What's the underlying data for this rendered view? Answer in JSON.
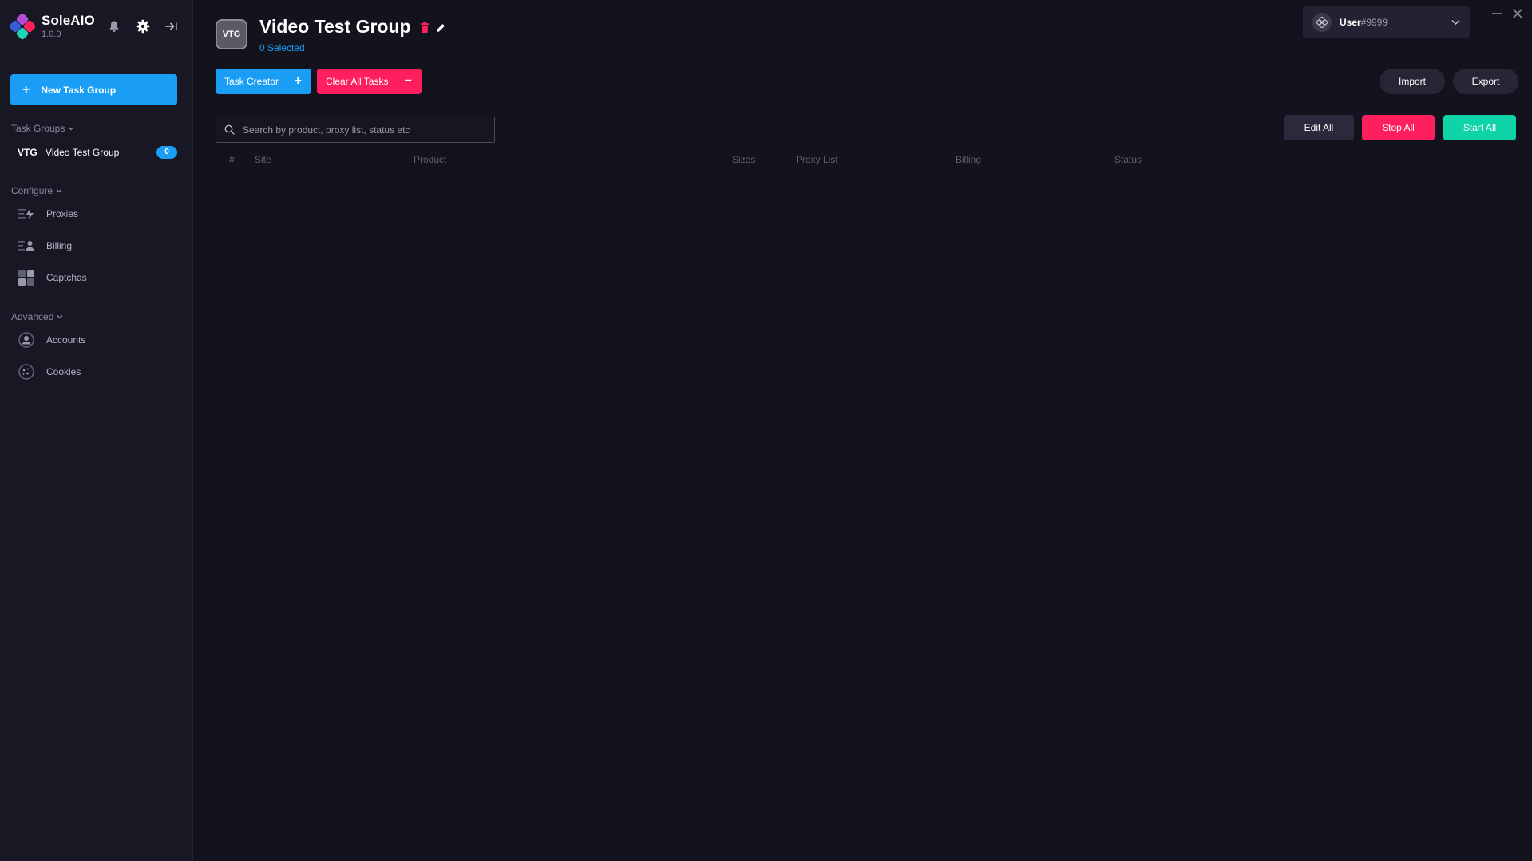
{
  "app": {
    "name": "SoleAIO",
    "version": "1.0.0"
  },
  "sidebar": {
    "new_task_group_label": "New Task Group",
    "task_groups_label": "Task Groups",
    "groups": [
      {
        "abbr": "VTG",
        "name": "Video Test Group",
        "count": "0"
      }
    ],
    "configure_label": "Configure",
    "configure_items": [
      {
        "label": "Proxies",
        "icon": "proxies-icon"
      },
      {
        "label": "Billing",
        "icon": "billing-icon"
      },
      {
        "label": "Captchas",
        "icon": "captchas-icon"
      }
    ],
    "advanced_label": "Advanced",
    "advanced_items": [
      {
        "label": "Accounts",
        "icon": "accounts-icon"
      },
      {
        "label": "Cookies",
        "icon": "cookies-icon"
      }
    ]
  },
  "header": {
    "group_abbr": "VTG",
    "title": "Video Test Group",
    "selected": "0 Selected"
  },
  "toolbar": {
    "task_creator_label": "Task Creator",
    "clear_all_label": "Clear All Tasks",
    "import_label": "Import",
    "export_label": "Export",
    "edit_all_label": "Edit All",
    "stop_all_label": "Stop All",
    "start_all_label": "Start All"
  },
  "search": {
    "placeholder": "Search by product, proxy list, status etc",
    "value": ""
  },
  "table": {
    "columns": [
      "#",
      "Site",
      "Product",
      "Sizes",
      "Proxy List",
      "Billing",
      "Status"
    ],
    "rows": []
  },
  "user": {
    "name": "User",
    "tag": "#9999"
  },
  "colors": {
    "accent_blue": "#1a9ef5",
    "danger_red": "#ff1f5e",
    "success_green": "#0fd4a8",
    "background": "#13131d",
    "sidebar": "#181824"
  }
}
